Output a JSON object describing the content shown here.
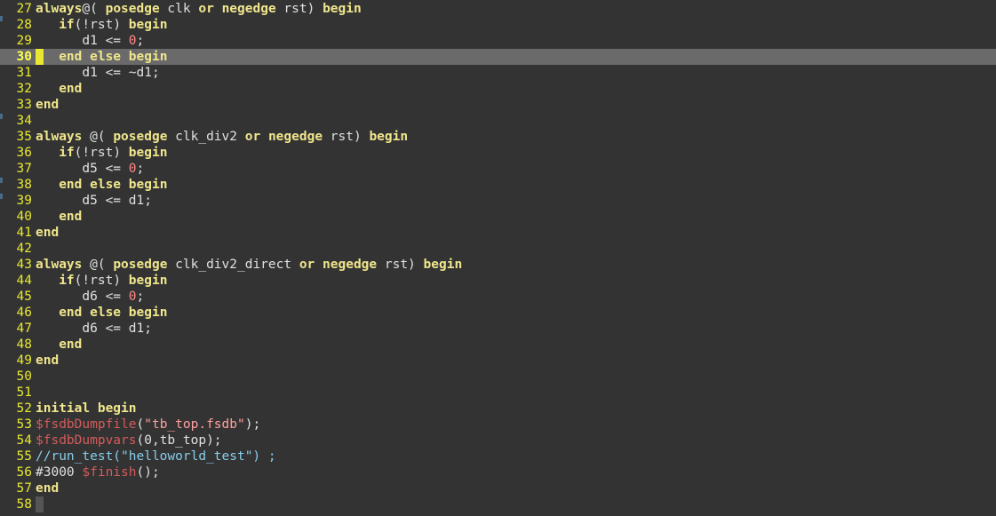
{
  "editor": {
    "current_line": 30,
    "lines": [
      {
        "n": "27",
        "tokens": [
          [
            "kw",
            "always"
          ],
          [
            "",
            ""
          ],
          [
            "",
            "@( "
          ],
          [
            "kw",
            "posedge"
          ],
          [
            "",
            " clk "
          ],
          [
            "kw",
            "or"
          ],
          [
            "",
            " "
          ],
          [
            "kw",
            "negedge"
          ],
          [
            "",
            " rst) "
          ],
          [
            "kw",
            "begin"
          ]
        ]
      },
      {
        "n": "28",
        "tokens": [
          [
            "",
            "   "
          ],
          [
            "kw",
            "if"
          ],
          [
            "",
            "(!rst) "
          ],
          [
            "kw",
            "begin"
          ]
        ]
      },
      {
        "n": "29",
        "tokens": [
          [
            "",
            "      d1 <= "
          ],
          [
            "num",
            "0"
          ],
          [
            "",
            ";"
          ]
        ]
      },
      {
        "n": "30",
        "tokens": [
          [
            "",
            "   "
          ],
          [
            "kw",
            "end else begin"
          ]
        ]
      },
      {
        "n": "31",
        "tokens": [
          [
            "",
            "      d1 <= ~d1;"
          ]
        ]
      },
      {
        "n": "32",
        "tokens": [
          [
            "",
            "   "
          ],
          [
            "kw",
            "end"
          ]
        ]
      },
      {
        "n": "33",
        "tokens": [
          [
            "kw",
            "end"
          ]
        ]
      },
      {
        "n": "34",
        "tokens": []
      },
      {
        "n": "35",
        "tokens": [
          [
            "kw",
            "always"
          ],
          [
            "",
            " @( "
          ],
          [
            "kw",
            "posedge"
          ],
          [
            "",
            " clk_div2 "
          ],
          [
            "kw",
            "or"
          ],
          [
            "",
            " "
          ],
          [
            "kw",
            "negedge"
          ],
          [
            "",
            " rst) "
          ],
          [
            "kw",
            "begin"
          ]
        ]
      },
      {
        "n": "36",
        "tokens": [
          [
            "",
            "   "
          ],
          [
            "kw",
            "if"
          ],
          [
            "",
            "(!rst) "
          ],
          [
            "kw",
            "begin"
          ]
        ]
      },
      {
        "n": "37",
        "tokens": [
          [
            "",
            "      d5 <= "
          ],
          [
            "num",
            "0"
          ],
          [
            "",
            ";"
          ]
        ]
      },
      {
        "n": "38",
        "tokens": [
          [
            "",
            "   "
          ],
          [
            "kw",
            "end else begin"
          ]
        ]
      },
      {
        "n": "39",
        "tokens": [
          [
            "",
            "      d5 <= d1;"
          ]
        ]
      },
      {
        "n": "40",
        "tokens": [
          [
            "",
            "   "
          ],
          [
            "kw",
            "end"
          ]
        ]
      },
      {
        "n": "41",
        "tokens": [
          [
            "kw",
            "end"
          ]
        ]
      },
      {
        "n": "42",
        "tokens": []
      },
      {
        "n": "43",
        "tokens": [
          [
            "kw",
            "always"
          ],
          [
            "",
            " @( "
          ],
          [
            "kw",
            "posedge"
          ],
          [
            "",
            " clk_div2_direct "
          ],
          [
            "kw",
            "or"
          ],
          [
            "",
            " "
          ],
          [
            "kw",
            "negedge"
          ],
          [
            "",
            " rst) "
          ],
          [
            "kw",
            "begin"
          ]
        ]
      },
      {
        "n": "44",
        "tokens": [
          [
            "",
            "   "
          ],
          [
            "kw",
            "if"
          ],
          [
            "",
            "(!rst) "
          ],
          [
            "kw",
            "begin"
          ]
        ]
      },
      {
        "n": "45",
        "tokens": [
          [
            "",
            "      d6 <= "
          ],
          [
            "num",
            "0"
          ],
          [
            "",
            ";"
          ]
        ]
      },
      {
        "n": "46",
        "tokens": [
          [
            "",
            "   "
          ],
          [
            "kw",
            "end else begin"
          ]
        ]
      },
      {
        "n": "47",
        "tokens": [
          [
            "",
            "      d6 <= d1;"
          ]
        ]
      },
      {
        "n": "48",
        "tokens": [
          [
            "",
            "   "
          ],
          [
            "kw",
            "end"
          ]
        ]
      },
      {
        "n": "49",
        "tokens": [
          [
            "kw",
            "end"
          ]
        ]
      },
      {
        "n": "50",
        "tokens": []
      },
      {
        "n": "51",
        "tokens": []
      },
      {
        "n": "52",
        "tokens": [
          [
            "kw",
            "initial begin"
          ]
        ]
      },
      {
        "n": "53",
        "tokens": [
          [
            "sys",
            "$fsdbDumpfile"
          ],
          [
            "",
            "("
          ],
          [
            "str",
            "\"tb_top.fsdb\""
          ],
          [
            "",
            ");"
          ]
        ]
      },
      {
        "n": "54",
        "tokens": [
          [
            "sys",
            "$fsdbDumpvars"
          ],
          [
            "",
            "(0,tb_top);"
          ]
        ]
      },
      {
        "n": "55",
        "tokens": [
          [
            "cmt",
            "//run_test(\"helloworld_test\") ;"
          ]
        ]
      },
      {
        "n": "56",
        "tokens": [
          [
            "",
            "#3000 "
          ],
          [
            "sys",
            "$finish"
          ],
          [
            "",
            "();"
          ]
        ]
      },
      {
        "n": "57",
        "tokens": [
          [
            "kw",
            "end"
          ]
        ]
      },
      {
        "n": "58",
        "tokens": []
      }
    ]
  }
}
